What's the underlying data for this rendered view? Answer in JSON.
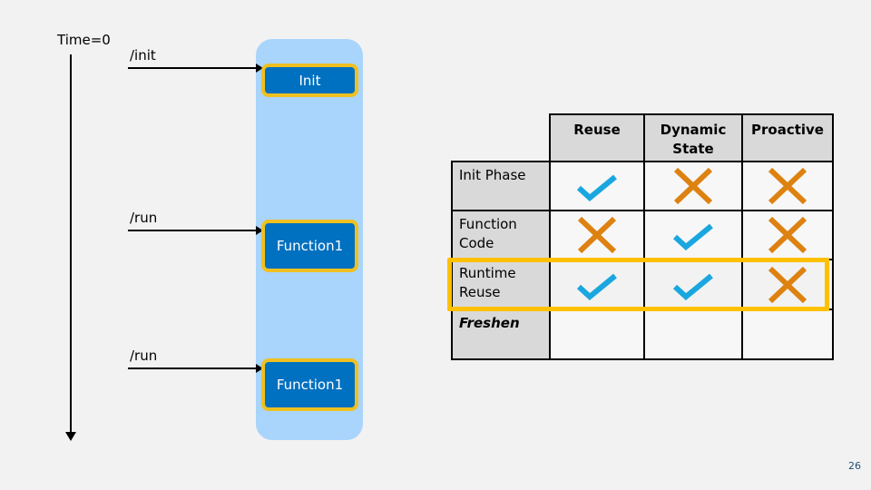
{
  "timeline": {
    "start_label": "Time=0"
  },
  "requests": [
    {
      "label": "/init",
      "target": "Init"
    },
    {
      "label": "/run",
      "target": "Function1"
    },
    {
      "label": "/run",
      "target": "Function1"
    }
  ],
  "colors": {
    "check": "#1aa7e0",
    "cross": "#dd8211",
    "highlight": "#ffc000",
    "box": "#0070c0",
    "container": "#a9d4fb"
  },
  "table": {
    "columns": [
      "Reuse",
      "Dynamic State",
      "Proactive"
    ],
    "columns_lines": [
      [
        "Reuse"
      ],
      [
        "Dynamic",
        "State"
      ],
      [
        "Proactive"
      ]
    ],
    "rows": [
      {
        "label": "Init Phase",
        "lines": [
          "Init Phase"
        ],
        "values": [
          "check",
          "cross",
          "cross"
        ],
        "italic": false
      },
      {
        "label": "Function Code",
        "lines": [
          "Function",
          "Code"
        ],
        "values": [
          "cross",
          "check",
          "cross"
        ],
        "italic": false
      },
      {
        "label": "Runtime Reuse",
        "lines": [
          "Runtime",
          "Reuse"
        ],
        "values": [
          "check",
          "check",
          "cross"
        ],
        "italic": false,
        "highlighted": true
      },
      {
        "label": "Freshen",
        "lines": [
          "Freshen"
        ],
        "values": [
          "",
          "",
          ""
        ],
        "italic": true
      }
    ]
  },
  "page_number": "26"
}
